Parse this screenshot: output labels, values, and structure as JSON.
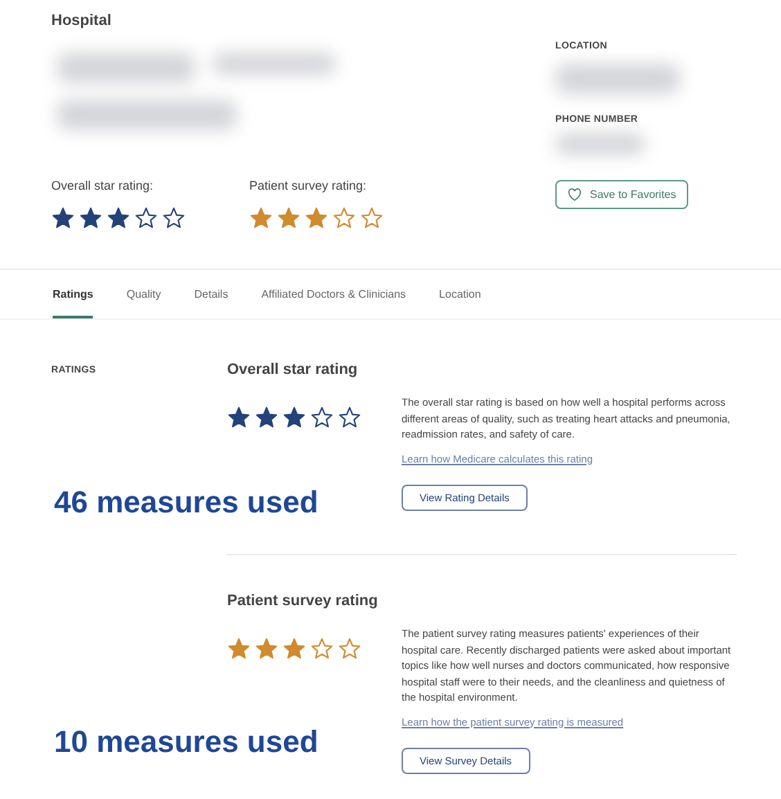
{
  "header": {
    "type_label": "Hospital",
    "location_label": "LOCATION",
    "phone_label": "PHONE NUMBER",
    "favorite_button": "Save to Favorites",
    "ratings": [
      {
        "label": "Overall star rating:",
        "stars": 3,
        "color": "#24427a"
      },
      {
        "label": "Patient survey rating:",
        "stars": 3,
        "color": "#d18a2e"
      }
    ]
  },
  "tabs": [
    {
      "label": "Ratings",
      "selected": true
    },
    {
      "label": "Quality",
      "selected": false
    },
    {
      "label": "Details",
      "selected": false
    },
    {
      "label": "Affiliated Doctors & Clinicians",
      "selected": false
    },
    {
      "label": "Location",
      "selected": false
    }
  ],
  "section_label": "RATINGS",
  "sections": [
    {
      "title": "Overall star rating",
      "stars": 3,
      "color": "#24427a",
      "description": "The overall star rating is based on how well a hospital performs across different areas of quality, such as treating heart attacks and pneumonia, readmission rates, and safety of care.",
      "link": "Learn how Medicare calculates this rating",
      "button": "View Rating Details",
      "measures": "46 measures used"
    },
    {
      "title": "Patient survey rating",
      "stars": 3,
      "color": "#d18a2e",
      "description": "The patient survey rating measures patients' experiences of their hospital care. Recently discharged patients were asked about important topics like how well nurses and doctors communicated, how responsive hospital staff were to their needs, and the cleanliness and quietness of the hospital environment.",
      "link": "Learn how the patient survey rating is measured",
      "button": "View Survey Details",
      "measures": "10 measures used"
    }
  ]
}
